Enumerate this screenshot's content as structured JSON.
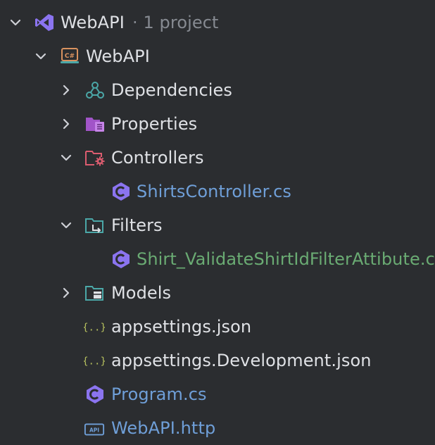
{
  "solution": {
    "name": "WebAPI",
    "meta": "· 1 project"
  },
  "project": {
    "name": "WebAPI"
  },
  "items": {
    "dependencies": "Dependencies",
    "properties": "Properties",
    "controllers": "Controllers",
    "shirts_controller": "ShirtsController.cs",
    "filters": "Filters",
    "filter_file": "Shirt_ValidateShirtIdFilterAttibute.cs",
    "models": "Models",
    "appsettings": "appsettings.json",
    "appsettings_dev": "appsettings.Development.json",
    "program": "Program.cs",
    "http": "WebAPI.http"
  },
  "icons": {
    "csharp_project_badge": "C#",
    "api_file_badge": "API",
    "json_badge": "{..}"
  },
  "colors": {
    "background": "#2b2d30",
    "text": "#dfe1e5",
    "muted": "#868a91",
    "file_blue": "#6f9fd8",
    "file_green": "#6aab73"
  }
}
